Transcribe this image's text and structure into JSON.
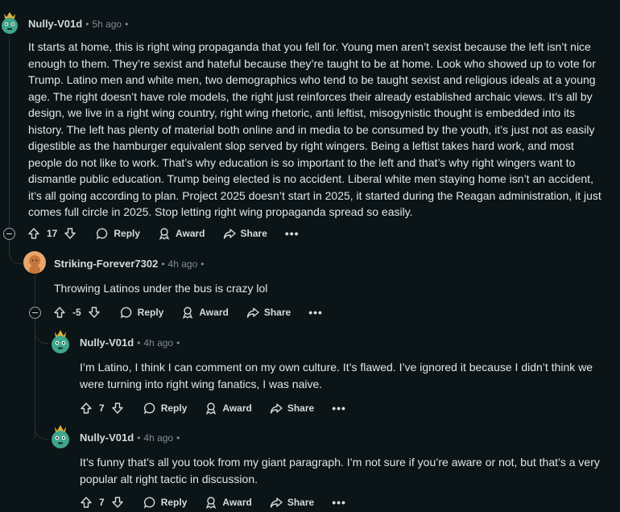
{
  "comments": [
    {
      "username": "Nully-V01d",
      "time": "5h ago",
      "body": "It starts at home, this is right wing propaganda that you fell for. Young men aren’t sexist because the left isn’t nice enough to them. They’re sexist and hateful because they’re taught to be at home. Look who showed up to vote for Trump. Latino men and white men, two demographics who tend to be taught sexist and religious ideals at a young age. The right doesn’t have role models, the right just reinforces their already established archaic views. It’s all by design, we live in a right wing country, right wing rhetoric, anti leftist, misogynistic thought is embedded into its history. The left has plenty of material both online and in media to be consumed by the youth, it’s just not as easily digestible as the hamburger equivalent slop served by right wingers. Being a leftist takes hard work, and most people do not like to work. That’s why education is so important to the left and that’s why right wingers want to dismantle public education. Trump being elected is no accident. Liberal white men staying home isn’t an accident, it’s all going according to plan. Project 2025 doesn’t start in 2025, it started during the Reagan administration, it just comes full circle in 2025. Stop letting right wing propaganda spread so easily.",
      "score": "17"
    },
    {
      "username": "Striking-Forever7302",
      "time": "4h ago",
      "body": "Throwing Latinos under the bus is crazy lol",
      "score": "-5"
    },
    {
      "username": "Nully-V01d",
      "time": "4h ago",
      "body": "I’m Latino, I think I can comment on my own culture. It’s flawed. I’ve ignored it because I didn’t think we were turning into right wing fanatics, I was naive.",
      "score": "7"
    },
    {
      "username": "Nully-V01d",
      "time": "4h ago",
      "body": "It’s funny that’s all you took from my giant paragraph. I’m not sure if you’re aware or not, but that’s a very popular alt right tactic in discussion.",
      "score": "7"
    }
  ],
  "labels": {
    "reply": "Reply",
    "award": "Award",
    "share": "Share",
    "more": "•••",
    "dot": "•"
  },
  "colors": {
    "background": "#0b1416",
    "text": "#d7dadc",
    "meta": "#828c91",
    "thread_line": "#2a3236",
    "avatar_green": "#3fa58b",
    "avatar_orange": "#e8a76b"
  },
  "icons": {
    "upvote": "upvote-arrow-icon",
    "downvote": "downvote-arrow-icon",
    "reply": "speech-bubble-icon",
    "award": "award-ribbon-icon",
    "share": "share-arrow-icon",
    "collapse": "minus-circle-icon",
    "more": "more-dots-icon"
  }
}
